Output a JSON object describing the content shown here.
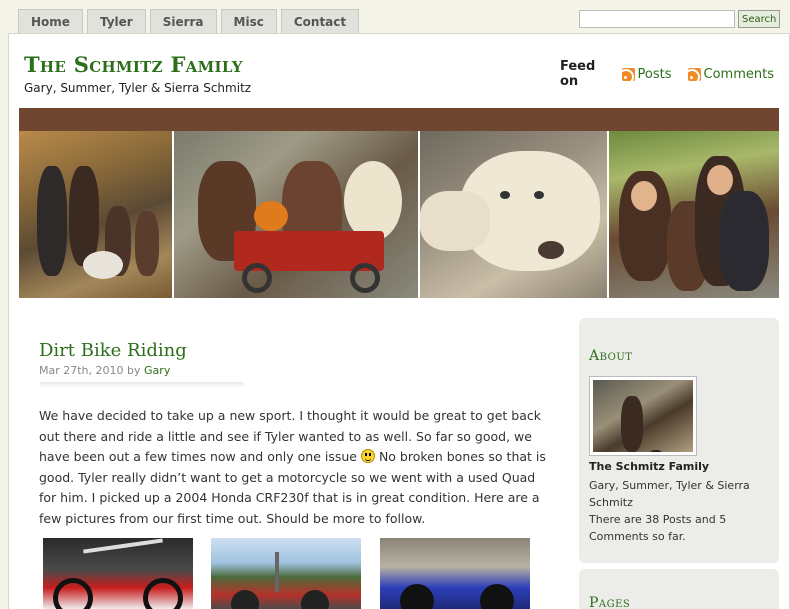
{
  "nav": {
    "tabs": [
      "Home",
      "Tyler",
      "Sierra",
      "Misc",
      "Contact"
    ]
  },
  "search": {
    "placeholder": "",
    "button_label": "Search"
  },
  "header": {
    "title": "The Schmitz Family",
    "description": "Gary, Summer, Tyler & Sierra Schmitz",
    "feed_label": "Feed on",
    "feed_posts": "Posts",
    "feed_comments": "Comments"
  },
  "post": {
    "title": "Dirt Bike Riding",
    "date": "Mar 27th, 2010",
    "by": "by",
    "author": "Gary",
    "body_1": "We have decided to take up a new sport. I thought it would be great to get back out there and ride a little and see if Tyler wanted to as well. So far so good, we have been out a few times now and only one issue",
    "body_2": " No broken bones so that is good. Tyler really didn’t want to get a motorcycle so we went with a used Quad for him. I picked up a 2004 Honda CRF230f that is in great condition. Here are a few pictures from our first time out. Should be more to follow."
  },
  "sidebar": {
    "about_heading": "About",
    "about_name": "The Schmitz Family",
    "about_members": "Gary, Summer, Tyler & Sierra Schmitz",
    "about_stats": "There are 38 Posts and 5 Comments so far.",
    "pages_heading": "Pages"
  },
  "icons": {
    "feed": "rss-icon",
    "smiley": "smiley-icon"
  },
  "colors": {
    "accent": "#2c6e1a",
    "banner": "#6f4630",
    "rss": "#f08a24"
  }
}
